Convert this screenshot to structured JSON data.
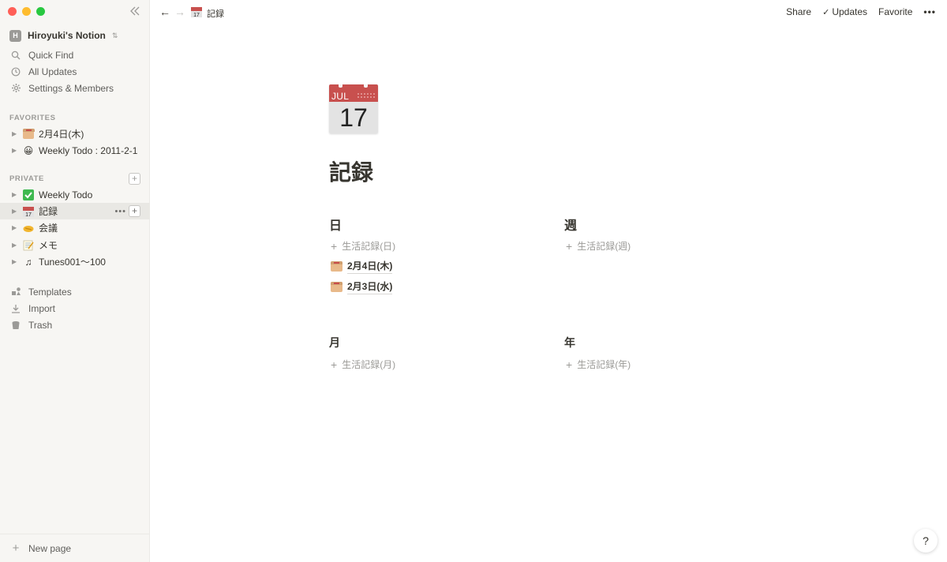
{
  "colors": {
    "close": "#ff5f57",
    "minimize": "#febc2e",
    "zoom": "#28c840",
    "sidebar_bg": "#f7f6f3",
    "text": "#37352f",
    "muted": "#9b9a97"
  },
  "sidebar": {
    "workspace_initial": "H",
    "workspace_name": "Hiroyuki's Notion",
    "nav": [
      {
        "label": "Quick Find",
        "icon": "search-icon"
      },
      {
        "label": "All Updates",
        "icon": "clock-icon"
      },
      {
        "label": "Settings & Members",
        "icon": "gear-icon"
      }
    ],
    "favorites_label": "FAVORITES",
    "favorites": [
      {
        "label": "2月4日(木)",
        "icon": "box-emoji-icon"
      },
      {
        "label": "Weekly Todo : 2011-2-1",
        "icon": "grinning-face-icon"
      }
    ],
    "private_label": "PRIVATE",
    "private": [
      {
        "label": "Weekly Todo",
        "icon": "check-mark-icon"
      },
      {
        "label": "記録",
        "icon": "calendar-icon"
      },
      {
        "label": "会議",
        "icon": "handshake-icon"
      },
      {
        "label": "メモ",
        "icon": "memo-icon"
      },
      {
        "label": "Tunes001〜100",
        "icon": "music-note-icon"
      }
    ],
    "bottom": [
      {
        "label": "Templates",
        "icon": "templates-icon"
      },
      {
        "label": "Import",
        "icon": "import-icon"
      },
      {
        "label": "Trash",
        "icon": "trash-icon"
      }
    ],
    "new_page": "New page"
  },
  "topbar": {
    "breadcrumb": "記録",
    "share": "Share",
    "updates": "Updates",
    "favorite": "Favorite",
    "more": "•••"
  },
  "page": {
    "icon_month": "JUL",
    "icon_day": "17",
    "title": "記録",
    "sections": [
      {
        "heading": "日",
        "new_label": "生活記録(日)",
        "entries": [
          "2月4日(木)",
          "2月3日(水)"
        ]
      },
      {
        "heading": "週",
        "new_label": "生活記録(週)",
        "entries": []
      },
      {
        "heading": "月",
        "new_label": "生活記録(月)",
        "entries": []
      },
      {
        "heading": "年",
        "new_label": "生活記録(年)",
        "entries": []
      }
    ]
  },
  "help_label": "?"
}
